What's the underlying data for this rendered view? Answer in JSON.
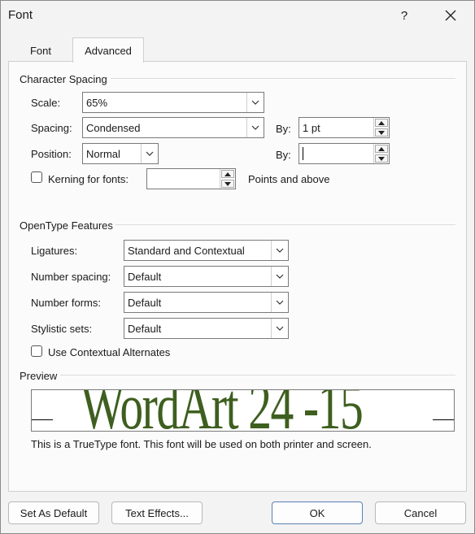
{
  "window": {
    "title": "Font"
  },
  "tabs": {
    "font": "Font",
    "advanced": "Advanced"
  },
  "character_spacing": {
    "header": "Character Spacing",
    "scale_label": "Scale:",
    "scale_value": "65%",
    "spacing_label": "Spacing:",
    "spacing_value": "Condensed",
    "spacing_by_label": "By:",
    "spacing_by_value": "1 pt",
    "position_label": "Position:",
    "position_value": "Normal",
    "position_by_label": "By:",
    "position_by_value": "",
    "kerning_label": "Kerning for fonts:",
    "kerning_value": "",
    "kerning_suffix": "Points and above"
  },
  "opentype": {
    "header": "OpenType Features",
    "ligatures_label": "Ligatures:",
    "ligatures_value": "Standard and Contextual",
    "number_spacing_label": "Number spacing:",
    "number_spacing_value": "Default",
    "number_forms_label": "Number forms:",
    "number_forms_value": "Default",
    "stylistic_sets_label": "Stylistic sets:",
    "stylistic_sets_value": "Default",
    "contextual_alternates_label": "Use Contextual Alternates"
  },
  "preview": {
    "header": "Preview",
    "sample_text": "WordArt 24 -15",
    "sample_color": "#3e5f1f",
    "description": "This is a TrueType font. This font will be used on both printer and screen."
  },
  "buttons": {
    "set_default": "Set As Default",
    "text_effects": "Text Effects...",
    "ok": "OK",
    "cancel": "Cancel"
  }
}
